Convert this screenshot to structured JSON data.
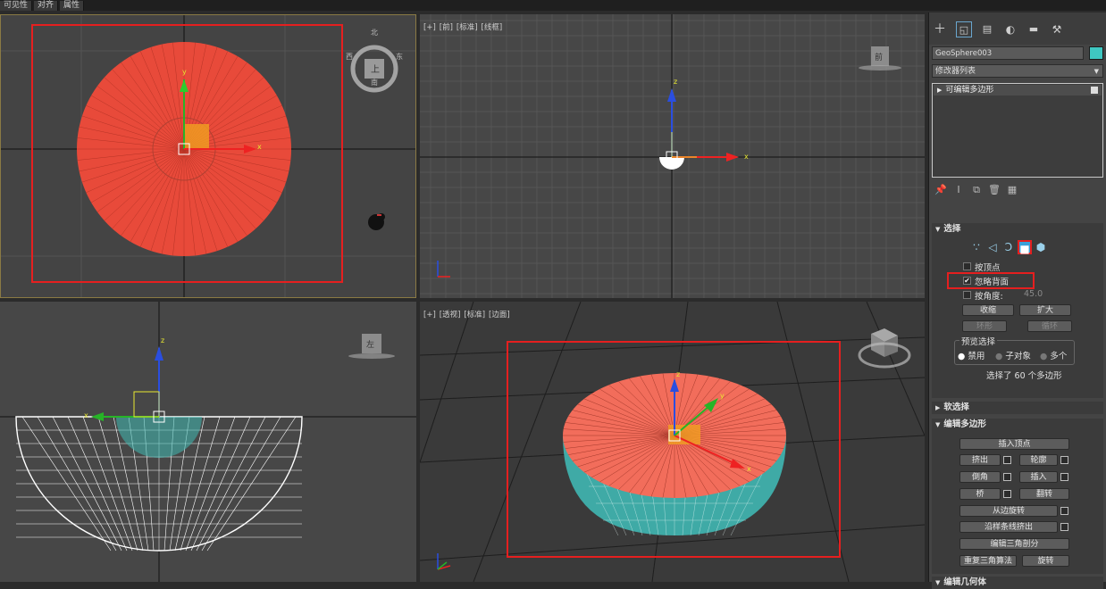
{
  "menu": [
    "可见性",
    "对齐",
    "属性"
  ],
  "viewports": {
    "top": {
      "compass": [
        "北",
        "南",
        "西",
        "东"
      ],
      "cube_face": "上"
    },
    "front": {
      "labels": [
        "[+]",
        "[前]",
        "[标准]",
        "[线框]"
      ],
      "cube_face": "前"
    },
    "left": {
      "cube_face": "左"
    },
    "persp": {
      "labels": [
        "[+]",
        "[透视]",
        "[标准]",
        "[边面]"
      ]
    }
  },
  "axes": {
    "x": "x",
    "y": "y",
    "z": "z"
  },
  "panel": {
    "object_name": "GeoSphere003",
    "object_color": "#3fc7c1",
    "modifier_list": "修改器列表",
    "stack_item": "可编辑多边形"
  },
  "selection": {
    "title": "选择",
    "by_vertex": "按顶点",
    "ignore_backfacing": "忽略背面",
    "by_angle": "按角度:",
    "angle_value": "45.0",
    "shrink": "收缩",
    "grow": "扩大",
    "ring": "环形",
    "loop": "循环",
    "preview_title": "预览选择",
    "preview_off": "禁用",
    "preview_subobj": "子对象",
    "preview_multi": "多个",
    "status": "选择了 60 个多边形"
  },
  "soft_selection": {
    "title": "软选择"
  },
  "edit_polygons": {
    "title": "编辑多边形",
    "insert_vertex": "插入顶点",
    "extrude": "挤出",
    "outline": "轮廓",
    "bevel": "倒角",
    "inset": "插入",
    "bridge": "桥",
    "flip": "翻转",
    "hinge_from_edge": "从边旋转",
    "extrude_along_spline": "沿样条线挤出",
    "edit_triangulation": "编辑三角剖分",
    "retriangulate": "重复三角算法",
    "turn": "旋转"
  },
  "edit_geometry": {
    "title": "编辑几何体"
  }
}
